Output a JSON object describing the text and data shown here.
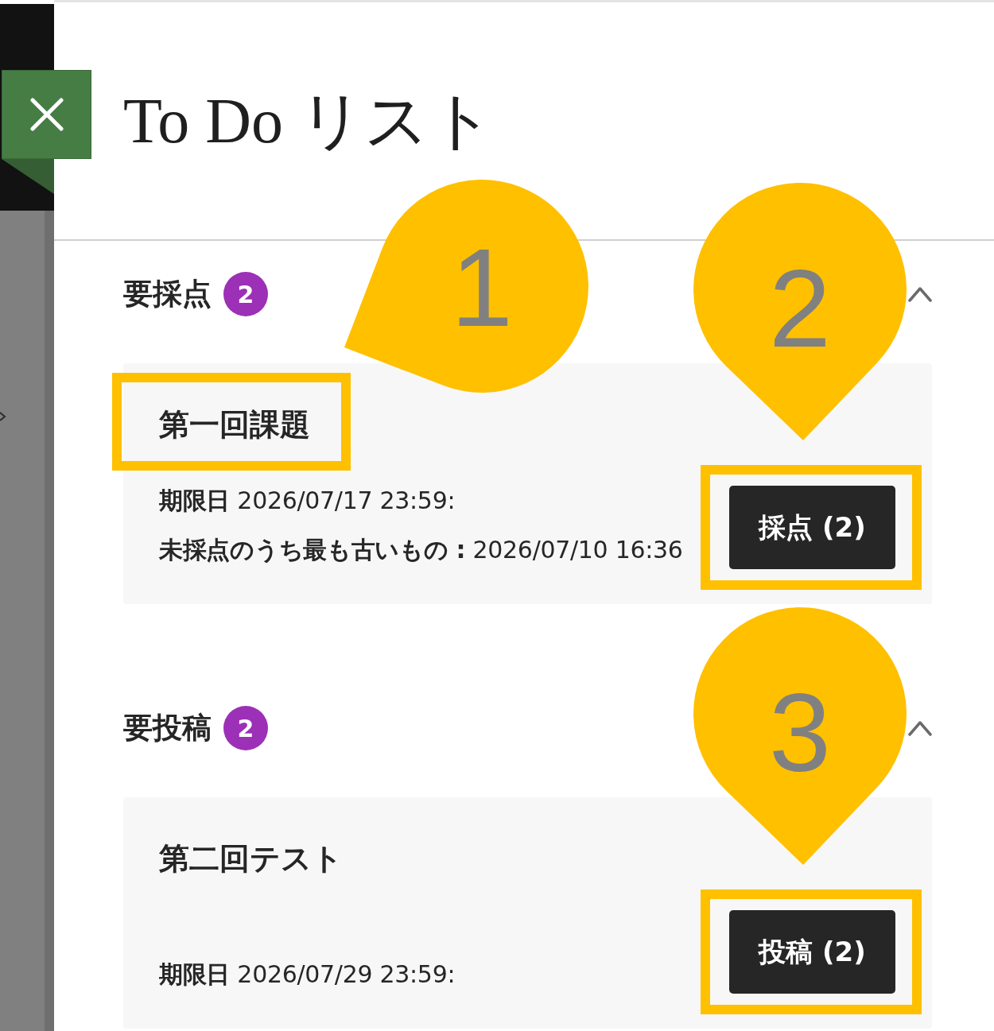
{
  "title": "To Do リスト",
  "sections": [
    {
      "label": "要採点",
      "count": "2",
      "expanded": true,
      "items": [
        {
          "title": {
            "text": "第一回課題",
            "highlighted": true,
            "callout": "1"
          },
          "details": [
            "**期限日** 2026/07/17 23:59:",
            "**未採点のうち最も古いもの :** 2026/07/10 16:36"
          ],
          "button": {
            "label": "採点 (2)",
            "highlighted": true,
            "callout": "2"
          }
        }
      ]
    },
    {
      "label": "要投稿",
      "count": "2",
      "expanded": true,
      "items": [
        {
          "title": {
            "text": "第二回テスト",
            "highlighted": false
          },
          "details": [
            "**期限日** 2026/07/29 23:59:"
          ],
          "button": {
            "label": "投稿 (2)",
            "highlighted": true,
            "callout": "3"
          }
        }
      ]
    }
  ]
}
